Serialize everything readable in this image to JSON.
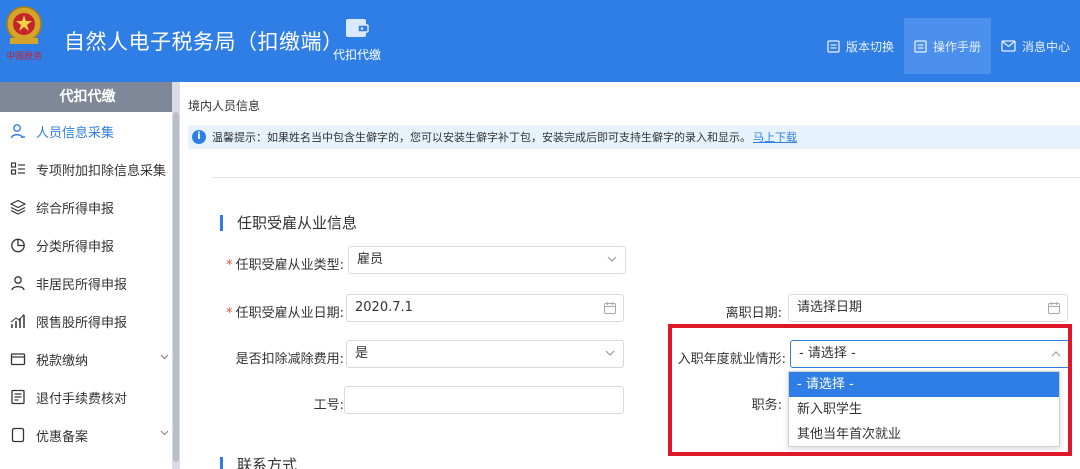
{
  "header": {
    "app_title": "自然人电子税务局（扣缴端）",
    "emblem_text": "中国税务",
    "module": {
      "label": "代扣代缴",
      "icon": "wallet-icon"
    },
    "actions": [
      {
        "label": "版本切换",
        "icon": "document-icon",
        "active": false
      },
      {
        "label": "操作手册",
        "icon": "document-icon",
        "active": true
      },
      {
        "label": "消息中心",
        "icon": "mail-icon",
        "active": false
      }
    ]
  },
  "sidebar": {
    "title": "代扣代缴",
    "items": [
      {
        "label": "人员信息采集",
        "icon": "person-icon",
        "active": true
      },
      {
        "label": "专项附加扣除信息采集",
        "icon": "list-icon"
      },
      {
        "label": "综合所得申报",
        "icon": "layers-icon"
      },
      {
        "label": "分类所得申报",
        "icon": "pie-chart-icon"
      },
      {
        "label": "非居民所得申报",
        "icon": "user-icon"
      },
      {
        "label": "限售股所得申报",
        "icon": "bar-chart-icon"
      },
      {
        "label": "税款缴纳",
        "icon": "folder-icon",
        "expandable": true
      },
      {
        "label": "退付手续费核对",
        "icon": "checklist-icon"
      },
      {
        "label": "优惠备案",
        "icon": "file-icon",
        "expandable": true
      }
    ]
  },
  "main": {
    "breadcrumb": "境内人员信息",
    "notice": {
      "text": "温馨提示：如果姓名当中包含生僻字的，您可以安装生僻字补丁包，安装完成后即可支持生僻字的录入和显示。",
      "link": "马上下载"
    },
    "section1_title": "任职受雇从业信息",
    "section2_title": "联系方式",
    "form": {
      "employment_type": {
        "label": "任职受雇从业类型:",
        "value": "雇员",
        "required": true
      },
      "employment_date": {
        "label": "任职受雇从业日期:",
        "value": "2020.7.1",
        "required": true
      },
      "leave_date": {
        "label": "离职日期:",
        "placeholder": "请选择日期"
      },
      "deduct_fee": {
        "label": "是否扣除减除费用:",
        "value": "是"
      },
      "first_employment": {
        "label": "入职年度就业情形:",
        "value": "- 请选择 -"
      },
      "employee_no": {
        "label": "工号:",
        "value": ""
      },
      "position": {
        "label": "职务:"
      }
    },
    "dropdown_options": [
      "- 请选择 -",
      "新入职学生",
      "其他当年首次就业"
    ],
    "dropdown_selected_index": 0
  },
  "colors": {
    "header_bg": "#2f7ee6",
    "accent": "#2f7ee6",
    "highlight": "#e0162b",
    "required": "#e5553c"
  }
}
